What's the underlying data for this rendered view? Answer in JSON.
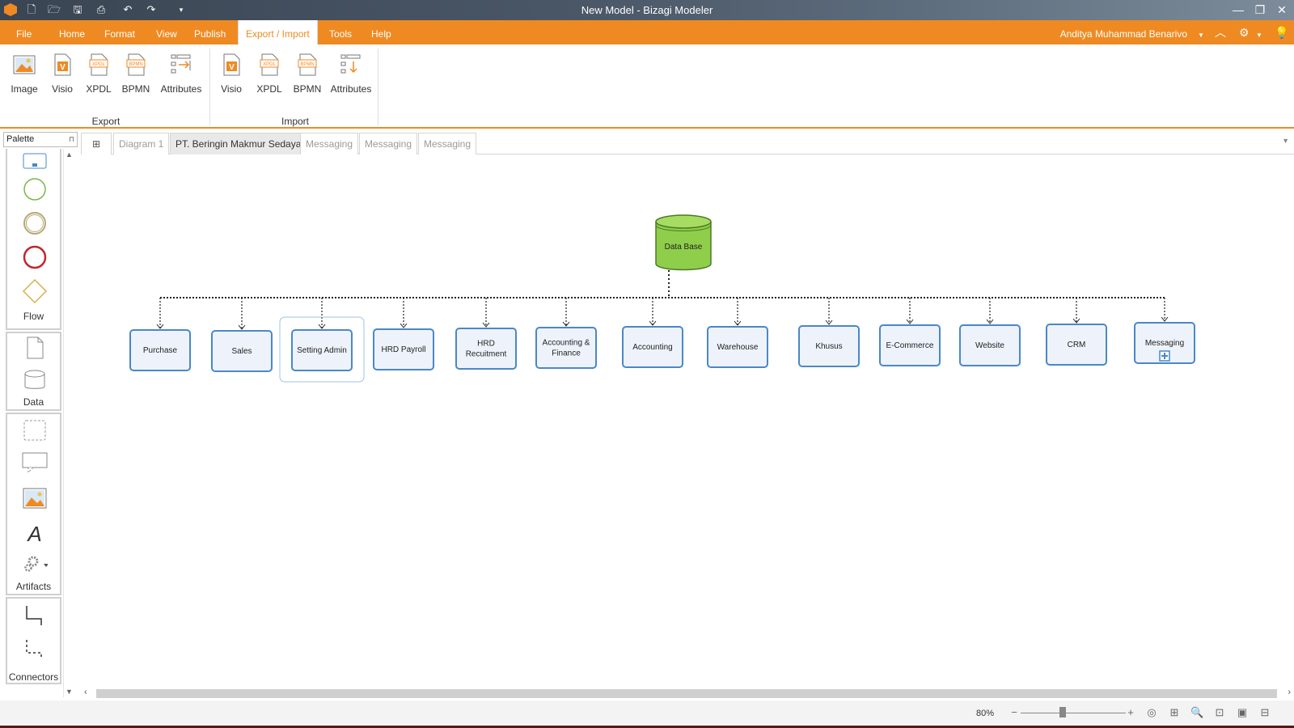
{
  "window": {
    "title": "New Model - Bizagi Modeler"
  },
  "menu": {
    "items": [
      "File",
      "Home",
      "Format",
      "View",
      "Publish",
      "Export / Import",
      "Tools",
      "Help"
    ],
    "active": "Export / Import",
    "user": "Anditya Muhammad Benarivo"
  },
  "ribbon": {
    "export": {
      "label": "Export",
      "buttons": [
        "Image",
        "Visio",
        "XPDL",
        "BPMN",
        "Attributes"
      ]
    },
    "import": {
      "label": "Import",
      "buttons": [
        "Visio",
        "XPDL",
        "BPMN",
        "Attributes"
      ]
    }
  },
  "palette": {
    "title": "Palette",
    "sections": [
      "Flow",
      "Data",
      "Artifacts",
      "Connectors"
    ]
  },
  "tabs": [
    "Diagram 1",
    "PT. Beringin Makmur Sedaya",
    "Messaging",
    "Messaging",
    "Messaging"
  ],
  "active_tab": "PT. Beringin Makmur Sedaya",
  "diagram": {
    "database": "Data Base",
    "nodes": [
      [
        "Purchase"
      ],
      [
        "Sales"
      ],
      [
        "Setting Admin"
      ],
      [
        "HRD Payroll"
      ],
      [
        "HRD",
        "Recuitment"
      ],
      [
        "Accounting &",
        "Finance"
      ],
      [
        "Accounting"
      ],
      [
        "Warehouse"
      ],
      [
        "Khusus"
      ],
      [
        "E-Commerce"
      ],
      [
        "Website"
      ],
      [
        "CRM"
      ],
      [
        "Messaging"
      ]
    ],
    "selected": "Setting Admin",
    "subprocess": "Messaging"
  },
  "status": {
    "zoom": "80%"
  },
  "colors": {
    "accent": "#ef8a22",
    "node_border": "#4a88c7",
    "node_fill": "#eef3fb",
    "db_fill": "#8fce4a"
  }
}
